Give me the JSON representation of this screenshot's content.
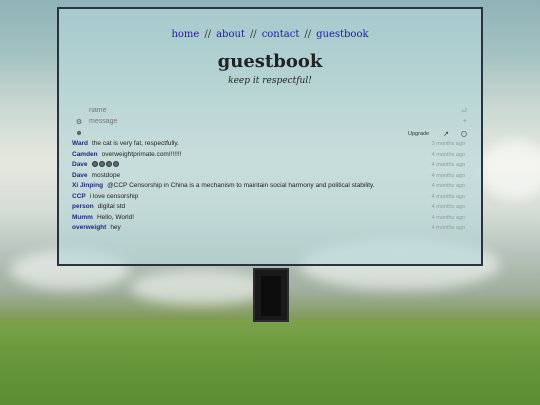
{
  "nav": {
    "items": [
      {
        "label": "home"
      },
      {
        "label": "about"
      },
      {
        "label": "contact"
      },
      {
        "label": "guestbook"
      }
    ],
    "separator": "//"
  },
  "page": {
    "title": "guestbook",
    "subtitle": "keep it respectful!"
  },
  "form": {
    "name_placeholder": "name",
    "message_placeholder": "message",
    "name_right_glyph": "⏎",
    "message_right_glyph": "+",
    "upgrade_label": "Upgrade",
    "icons": [
      "gear-icon",
      "user-icon",
      "external-link-icon",
      "circle-icon"
    ]
  },
  "entries": [
    {
      "user": "Ward",
      "message": "the cat is very fat, respectfully.",
      "time": "3 months ago"
    },
    {
      "user": "Camden",
      "message": "overweightprimate.com!!!!!!!",
      "time": "4 months ago"
    },
    {
      "user": "Dave",
      "message": "",
      "time": "4 months ago",
      "emoji_count": 4
    },
    {
      "user": "Dave",
      "message": "mostdope",
      "time": "4 months ago"
    },
    {
      "user": "Xi Jinping",
      "message": "@CCP Censorship in China is a mechanism to maintain social harmony and political stability.",
      "time": "4 months ago"
    },
    {
      "user": "CCP",
      "message": "i love censorship",
      "time": "4 months ago"
    },
    {
      "user": "person",
      "message": "digital std",
      "time": "4 months ago"
    },
    {
      "user": "Mumm",
      "message": "Hello, World!",
      "time": "4 months ago"
    },
    {
      "user": "overweight",
      "message": "hey",
      "time": "4 months ago"
    }
  ]
}
